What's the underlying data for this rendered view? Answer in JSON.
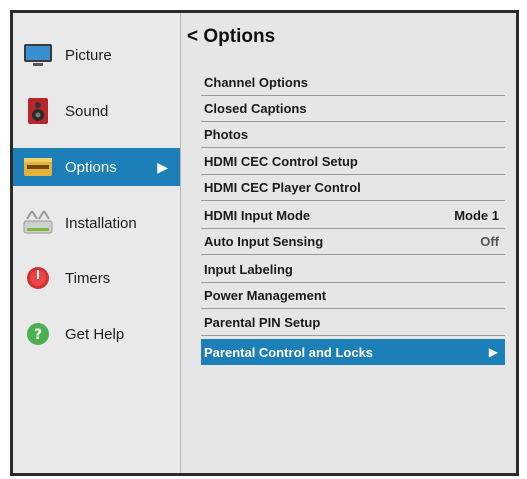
{
  "sidebar": {
    "items": [
      {
        "label": "Picture",
        "icon": "monitor-icon"
      },
      {
        "label": "Sound",
        "icon": "speaker-icon"
      },
      {
        "label": "Options",
        "icon": "options-icon",
        "active": true,
        "arrow": "▶"
      },
      {
        "label": "Installation",
        "icon": "installation-icon"
      },
      {
        "label": "Timers",
        "icon": "timer-icon"
      },
      {
        "label": "Get Help",
        "icon": "help-icon"
      }
    ]
  },
  "main": {
    "title": "< Options",
    "items": [
      {
        "label": "Channel Options",
        "value": ""
      },
      {
        "label": "Closed Captions",
        "value": ""
      },
      {
        "label": "Photos",
        "value": ""
      },
      {
        "label": "HDMI CEC Control Setup",
        "value": ""
      },
      {
        "label": "HDMI CEC Player Control",
        "value": ""
      },
      {
        "label": "HDMI Input Mode",
        "value": "Mode 1"
      },
      {
        "label": "Auto Input Sensing",
        "value": "Off"
      },
      {
        "label": "Input Labeling",
        "value": ""
      },
      {
        "label": "Power Management",
        "value": ""
      },
      {
        "label": "Parental PIN Setup",
        "value": ""
      },
      {
        "label": "Parental Control and Locks",
        "value": "",
        "selected": true,
        "arrow": "▶"
      }
    ]
  },
  "colors": {
    "accent": "#1d7fb8",
    "background": "#e6e6e6",
    "frame": "#2b2b2b"
  }
}
